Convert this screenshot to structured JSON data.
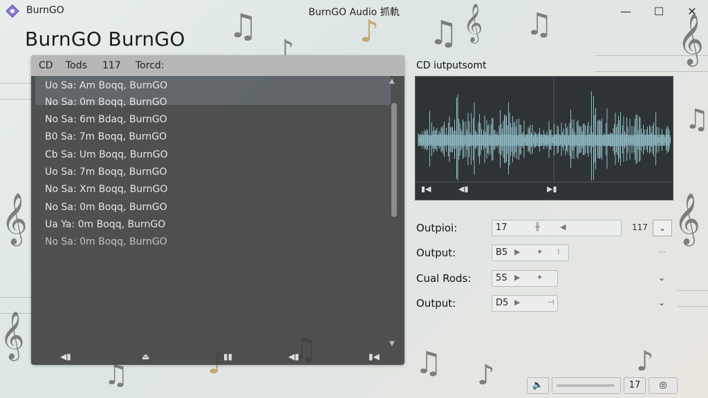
{
  "window": {
    "app_name": "BurnGO",
    "title": "BurnGO Audio 抓軌",
    "minimize_glyph": "—",
    "maximize_glyph": "☐",
    "close_glyph": "✕"
  },
  "heading": "BurnGO BurnGO",
  "track_list": {
    "headers": [
      "CD",
      "Tods",
      "117",
      "Torcd:"
    ],
    "rows": [
      "Uo Sa: Am Boqq, BurnGO",
      "No Sa: 0m Boqq, BurnGO",
      "No Sa: 6m Bdaq, BurnGO",
      "B0 Sa: 7m Boqq, BurnGO",
      "Cb Sa: Um Boqq, BurnGO",
      "Uo Sa: 7m Boqq, BurnGO",
      "No Sa: Xm Boqq, BurnGO",
      "No Sa: 0m Boqq, BurnGO",
      "Ua Ya: 0m Boqq, BurnGO",
      "No Sa: 0m Boqq, BurnGO"
    ],
    "scroll_position": 0.1
  },
  "output": {
    "title": "CD iutputsomt",
    "rows": [
      {
        "label": "Outpioi:",
        "value": "17",
        "extra": "117"
      },
      {
        "label": "Output:",
        "value": "B5",
        "extra": "···"
      },
      {
        "label": "Cual Rods:",
        "value": "5S",
        "extra": ""
      },
      {
        "label": "Output:",
        "value": "D5",
        "extra": ""
      }
    ]
  },
  "statusbar": {
    "value": "17"
  },
  "colors": {
    "waveform": "#8fbcc4",
    "panel_dark": "#3a3a3a",
    "header_light": "#c8c8c8"
  }
}
